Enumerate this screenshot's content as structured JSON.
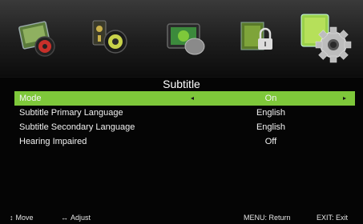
{
  "menu_tabs": [
    {
      "icon": "picture-icon",
      "active": false
    },
    {
      "icon": "sound-icon",
      "active": false
    },
    {
      "icon": "tv-icon",
      "active": false
    },
    {
      "icon": "lock-icon",
      "active": false
    },
    {
      "icon": "setup-gear-icon",
      "active": true
    }
  ],
  "title": "Subtitle",
  "rows": [
    {
      "label": "Mode",
      "value": "On",
      "selected": true
    },
    {
      "label": "Subtitle Primary Language",
      "value": "English",
      "selected": false
    },
    {
      "label": "Subtitle Secondary Language",
      "value": "English",
      "selected": false
    },
    {
      "label": "Hearing Impaired",
      "value": "Off",
      "selected": false
    }
  ],
  "footer": {
    "move_glyph": "↕",
    "move_label": "Move",
    "adjust_glyph": "↔",
    "adjust_label": "Adjust",
    "menu_label": "MENU: Return",
    "exit_label": "EXIT: Exit"
  },
  "colors": {
    "selected_row": "#7ec83a",
    "background": "#050505",
    "text": "#f2f2f2"
  }
}
